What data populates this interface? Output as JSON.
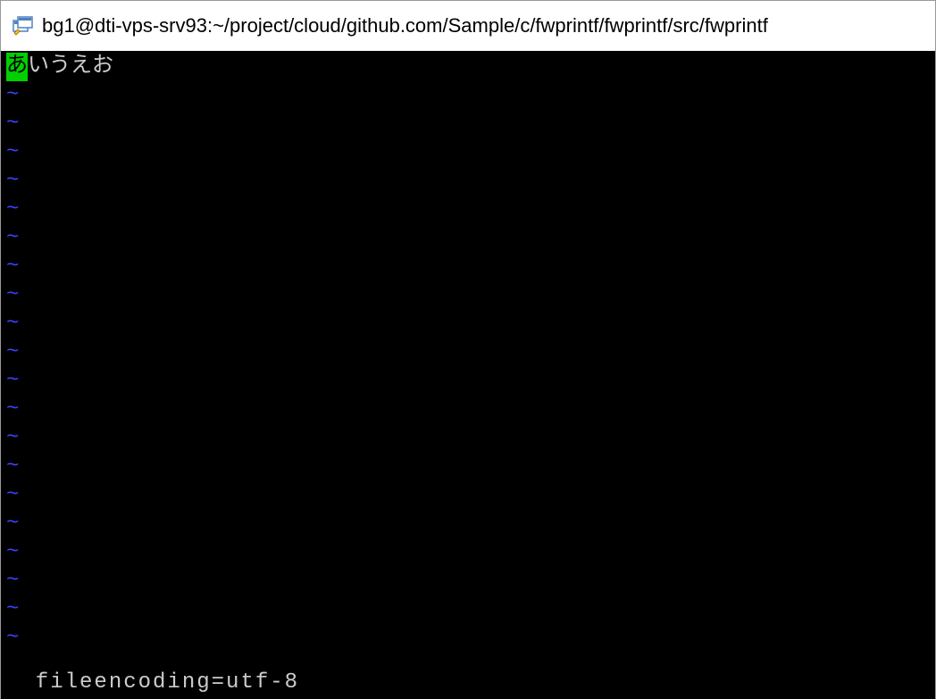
{
  "titlebar": {
    "text": "bg1@dti-vps-srv93:~/project/cloud/github.com/Sample/c/fwprintf/fwprintf/src/fwprintf"
  },
  "editor": {
    "cursor_char": "あ",
    "rest_of_line": "いうえお",
    "empty_marker": "~",
    "empty_line_count": 20
  },
  "status": {
    "text": "  fileencoding=utf-8"
  }
}
